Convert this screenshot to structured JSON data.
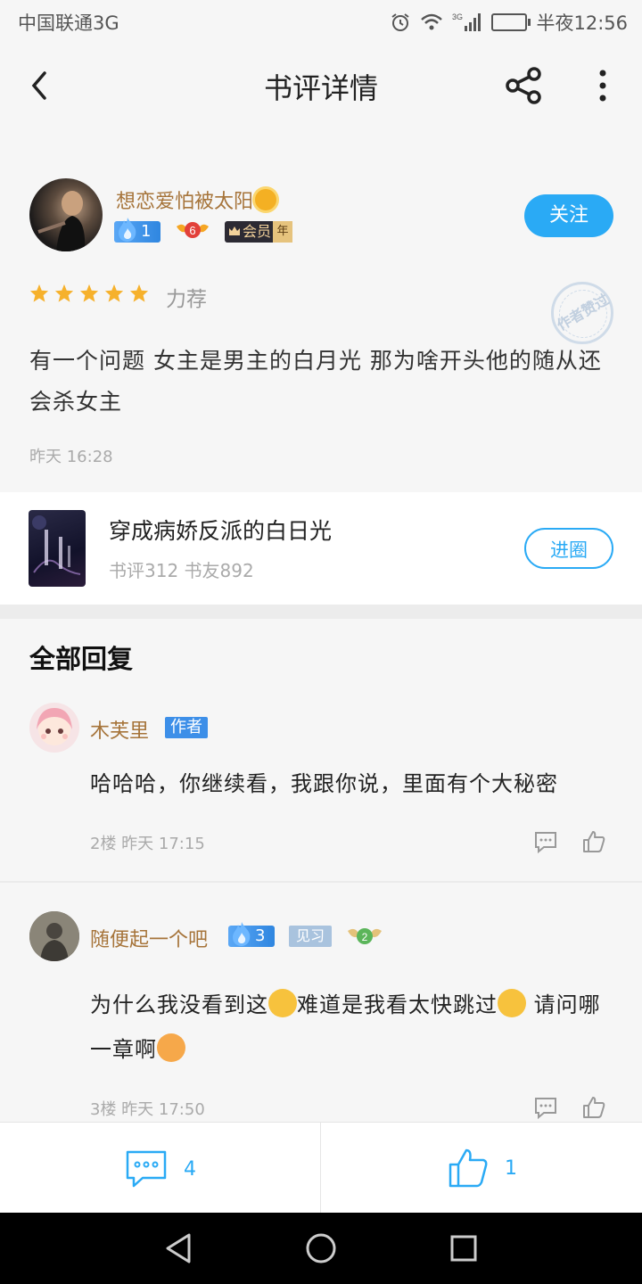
{
  "status_bar": {
    "carrier": "中国联通3G",
    "time": "半夜12:56",
    "network": "3G"
  },
  "header": {
    "title": "书评详情"
  },
  "review": {
    "username": "想恋爱怕被太阳",
    "fire_level": "1",
    "level_badge": "6",
    "vip_label": "会员",
    "vip_year": "年",
    "follow_label": "关注",
    "stars": 5,
    "rating_label": "力荐",
    "stamp_text": "作者赞过",
    "text": "有一个问题 女主是男主的白月光 那为啥开头他的随从还会杀女主",
    "time": "昨天 16:28"
  },
  "book": {
    "title": "穿成病娇反派的白日光",
    "stats": "书评312 书友892",
    "join_label": "进圈"
  },
  "replies_section": {
    "title": "全部回复"
  },
  "comments": [
    {
      "name": "木芙里",
      "tag": "作者",
      "text": "哈哈哈，你继续看，我跟你说，里面有个大秘密",
      "meta": "2楼 昨天 17:15"
    },
    {
      "name": "随便起一个吧",
      "fire_level": "3",
      "tag": "见习",
      "wing_level": "2",
      "text_part1": "为什么我没看到这",
      "text_part2": "难道是我看太快跳过",
      "text_part3": " 请问哪一章啊",
      "meta": "3楼 昨天 17:50"
    }
  ],
  "bottom_bar": {
    "comment_count": "4",
    "like_count": "1"
  },
  "colors": {
    "accent": "#2aaaf5",
    "username": "#a6743a",
    "star": "#f6b12c"
  }
}
